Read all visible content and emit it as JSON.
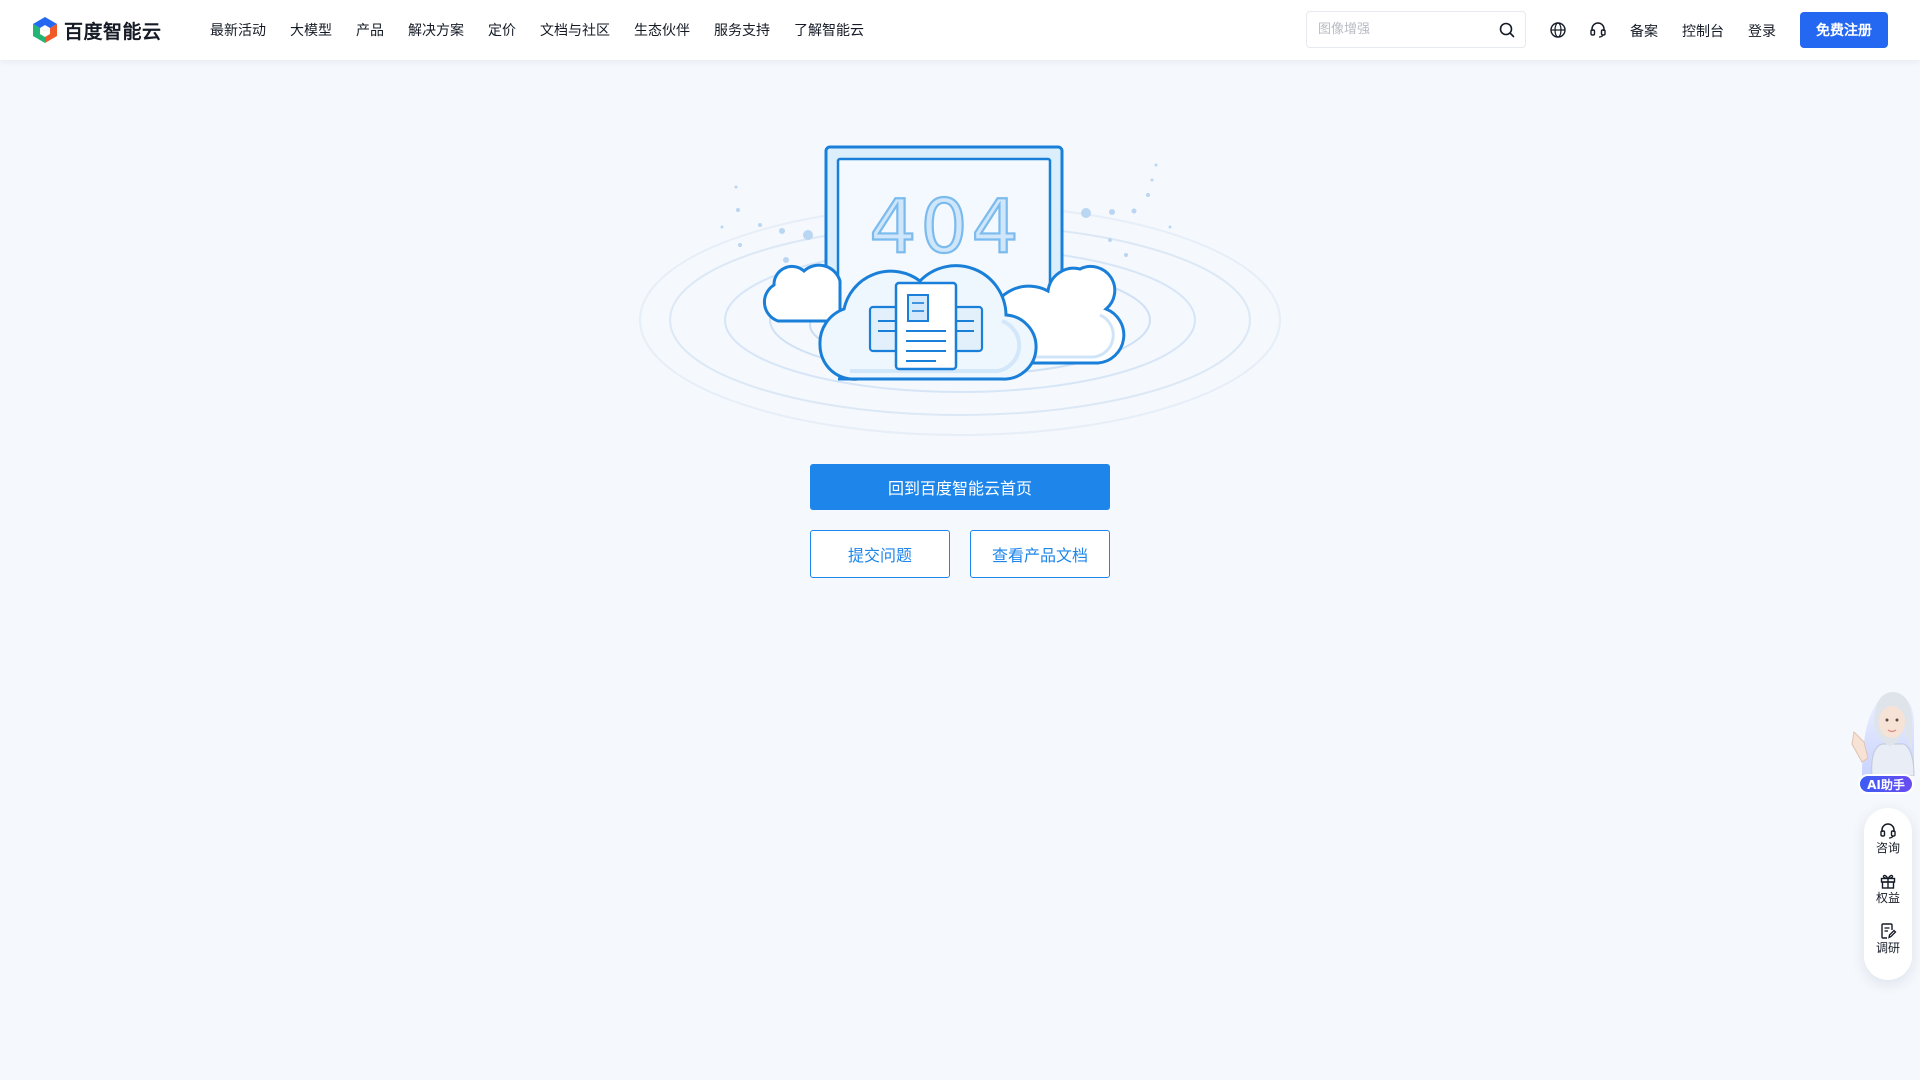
{
  "brand": {
    "name": "百度智能云"
  },
  "nav": {
    "items": [
      {
        "label": "最新活动"
      },
      {
        "label": "大模型"
      },
      {
        "label": "产品"
      },
      {
        "label": "解决方案"
      },
      {
        "label": "定价"
      },
      {
        "label": "文档与社区"
      },
      {
        "label": "生态伙伴"
      },
      {
        "label": "服务支持"
      },
      {
        "label": "了解智能云"
      }
    ]
  },
  "search": {
    "placeholder": "图像增强",
    "icon": "search-icon"
  },
  "header_right": {
    "globe_icon": "globe-icon",
    "support_icon": "headset-icon",
    "filing": "备案",
    "console": "控制台",
    "login": "登录",
    "signup": "免费注册"
  },
  "error": {
    "code": "404"
  },
  "actions": {
    "home": "回到百度智能云首页",
    "submit_issue": "提交问题",
    "view_docs": "查看产品文档"
  },
  "floating": {
    "ai_assistant": "AI助手",
    "items": [
      {
        "label": "咨询",
        "icon": "headset-icon"
      },
      {
        "label": "权益",
        "icon": "gift-icon"
      },
      {
        "label": "调研",
        "icon": "survey-icon"
      }
    ]
  },
  "colors": {
    "brand_blue": "#2468f2",
    "primary_button": "#1e86ea",
    "page_background": "#f5f8fc"
  }
}
